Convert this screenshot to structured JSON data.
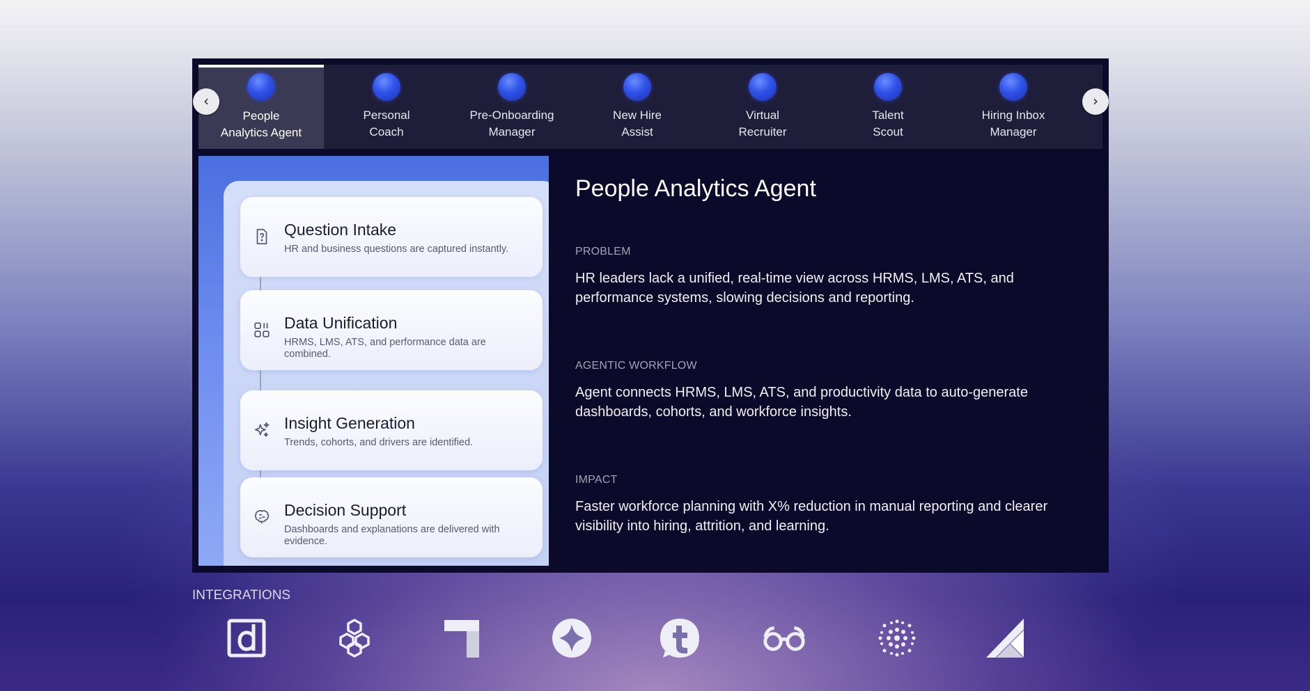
{
  "tabs": [
    {
      "label": "People\nAnalytics Agent",
      "icon": "agent-orb",
      "active": true
    },
    {
      "label": "Personal\nCoach",
      "icon": "agent-orb"
    },
    {
      "label": "Pre-Onboarding\nManager",
      "icon": "agent-orb"
    },
    {
      "label": "New Hire\nAssist",
      "icon": "agent-orb"
    },
    {
      "label": "Virtual\nRecruiter",
      "icon": "agent-orb"
    },
    {
      "label": "Talent\nScout",
      "icon": "agent-orb"
    },
    {
      "label": "Hiring Inbox\nManager",
      "icon": "agent-orb"
    }
  ],
  "nav": {
    "prev": "‹",
    "next": "›"
  },
  "steps": [
    {
      "title": "Question Intake",
      "desc": "HR and business questions are captured instantly.",
      "icon": "question-doc-icon"
    },
    {
      "title": "Data Unification",
      "desc": "HRMS, LMS, ATS, and performance data are combined.",
      "icon": "data-blocks-icon"
    },
    {
      "title": "Insight Generation",
      "desc": "Trends, cohorts, and drivers are identified.",
      "icon": "sparkle-icon"
    },
    {
      "title": "Decision Support",
      "desc": "Dashboards and explanations are delivered with evidence.",
      "icon": "brain-icon"
    }
  ],
  "detail": {
    "title": "People Analytics Agent",
    "problem_label": "PROBLEM",
    "problem_text": "HR leaders lack a unified, real-time view across HRMS, LMS, ATS, and performance systems, slowing decisions and reporting.",
    "workflow_label": "AGENTIC WORKFLOW",
    "workflow_text": "Agent connects HRMS, LMS, ATS, and productivity data to auto-generate dashboards, cohorts, and workforce insights.",
    "impact_label": "IMPACT",
    "impact_text": "Faster workforce planning with X% reduction in manual reporting and clearer visibility into hiring, attrition, and learning."
  },
  "integrations": {
    "label": "INTEGRATIONS",
    "icons": [
      "d-logo-icon",
      "hexagon-cubes-icon",
      "notion-block-icon",
      "star-circle-icon",
      "t-circle-icon",
      "glasses-icon",
      "snowflake-icon",
      "triangle-logo-icon"
    ]
  },
  "colors": {
    "panel": "#0c0a2a",
    "tabbar": "#1f1e3a",
    "active_tab": "#3a3a55",
    "orb": "#2f52e6",
    "accent_blue": "#4a6fe0"
  }
}
